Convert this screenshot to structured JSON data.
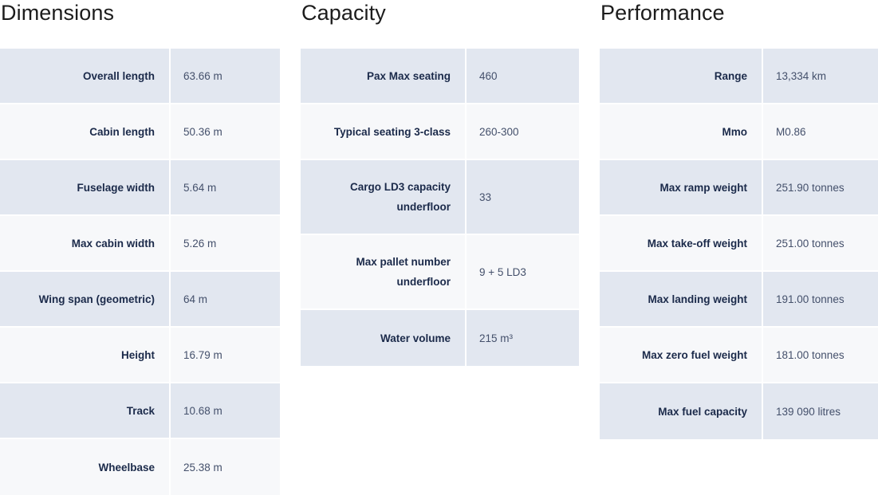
{
  "columns": [
    {
      "heading": "Dimensions",
      "rows": [
        {
          "label": "Overall length",
          "value": "63.66 m"
        },
        {
          "label": "Cabin length",
          "value": "50.36 m"
        },
        {
          "label": "Fuselage width",
          "value": "5.64 m"
        },
        {
          "label": "Max cabin width",
          "value": "5.26 m"
        },
        {
          "label": "Wing span (geometric)",
          "value": "64 m"
        },
        {
          "label": "Height",
          "value": "16.79 m"
        },
        {
          "label": "Track",
          "value": "10.68 m"
        },
        {
          "label": "Wheelbase",
          "value": "25.38 m"
        }
      ]
    },
    {
      "heading": "Capacity",
      "rows": [
        {
          "label": "Pax Max seating",
          "value": "460"
        },
        {
          "label": "Typical seating 3-class",
          "value": "260-300"
        },
        {
          "label": "Cargo LD3 capacity underfloor",
          "value": "33",
          "tall": true
        },
        {
          "label": "Max pallet number underfloor",
          "value": "9 + 5 LD3",
          "tall": true
        },
        {
          "label": "Water volume",
          "value": "215 m³"
        }
      ]
    },
    {
      "heading": "Performance",
      "rows": [
        {
          "label": "Range",
          "value": "13,334 km"
        },
        {
          "label": "Mmo",
          "value": "M0.86"
        },
        {
          "label": "Max ramp weight",
          "value": "251.90 tonnes"
        },
        {
          "label": "Max take-off weight",
          "value": "251.00 tonnes"
        },
        {
          "label": "Max landing weight",
          "value": "191.00 tonnes"
        },
        {
          "label": "Max zero fuel weight",
          "value": "181.00 tonnes"
        },
        {
          "label": "Max fuel capacity",
          "value": "139 090 litres"
        }
      ]
    }
  ],
  "colors": {
    "page_background": "#ffffff",
    "row_shade": "#e2e7f0",
    "row_plain": "#f7f8fa",
    "label_text": "#1b2a4a",
    "value_text": "#44506b",
    "heading_text": "#1c1c1c"
  }
}
